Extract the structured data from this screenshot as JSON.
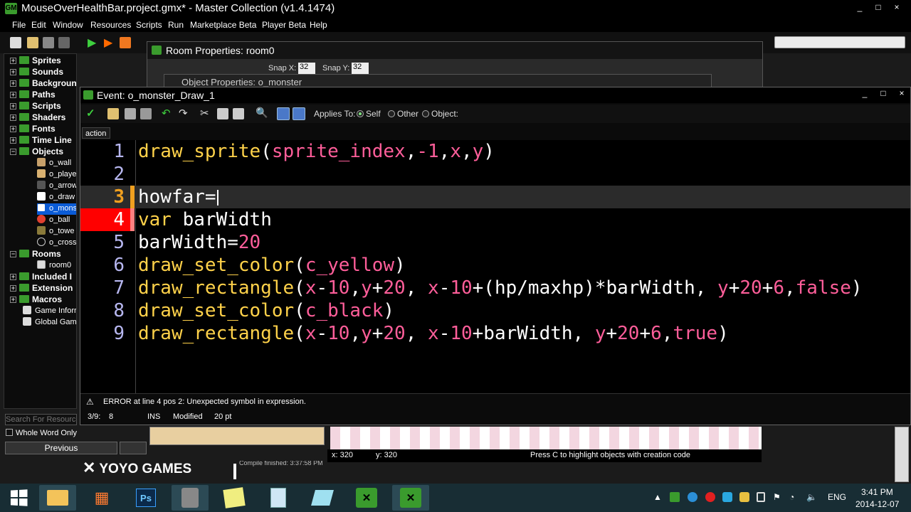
{
  "window": {
    "title": "MouseOverHealthBar.project.gmx* - Master Collection (v1.4.1474)",
    "controls": [
      "_",
      "□",
      "×"
    ]
  },
  "menu": [
    "File",
    "Edit",
    "Window",
    "Resources",
    "Scripts",
    "Run",
    "Marketplace Beta",
    "Player Beta",
    "Help"
  ],
  "resource_tree": {
    "folders": [
      {
        "label": "Sprites"
      },
      {
        "label": "Sounds"
      },
      {
        "label": "Backgrounds"
      },
      {
        "label": "Paths"
      },
      {
        "label": "Scripts"
      },
      {
        "label": "Shaders"
      },
      {
        "label": "Fonts"
      },
      {
        "label": "Time Line"
      },
      {
        "label": "Objects"
      }
    ],
    "objects": [
      {
        "label": "o_wall"
      },
      {
        "label": "o_playe"
      },
      {
        "label": "o_arrow"
      },
      {
        "label": "o_draw"
      },
      {
        "label": "o_monst"
      },
      {
        "label": "o_ball"
      },
      {
        "label": "o_towe"
      },
      {
        "label": "o_cross"
      }
    ],
    "rooms_folder": "Rooms",
    "room0": "room0",
    "included": "Included I",
    "extension": "Extension",
    "macros": "Macros",
    "game_info": "Game Inforr",
    "global_game": "Global Gam"
  },
  "search": {
    "placeholder": "Search For Resource",
    "whole_word": "Whole Word Only",
    "previous": "Previous"
  },
  "branding": "YOYO GAMES",
  "room_window": {
    "title": "Room Properties: room0",
    "snap_x_label": "Snap X:",
    "snap_x": "32",
    "snap_y_label": "Snap Y:",
    "snap_y": "32"
  },
  "object_window": {
    "title": "Object Properties: o_monster"
  },
  "event_window": {
    "title": "Event: o_monster_Draw_1",
    "applies_to": "Applies To:",
    "opt_self": "Self",
    "opt_other": "Other",
    "opt_object": "Object:",
    "tab": "action"
  },
  "code_lines": [
    {
      "n": "1",
      "parts": [
        [
          "fn",
          "draw_sprite"
        ],
        [
          "plain",
          "("
        ],
        [
          "var",
          "sprite_index"
        ],
        [
          "plain",
          ","
        ],
        [
          "num",
          "-1"
        ],
        [
          "plain",
          ","
        ],
        [
          "var",
          "x"
        ],
        [
          "plain",
          ","
        ],
        [
          "var",
          "y"
        ],
        [
          "plain",
          ")"
        ]
      ]
    },
    {
      "n": "2",
      "parts": []
    },
    {
      "n": "3",
      "parts": [
        [
          "plain",
          "howfar="
        ]
      ]
    },
    {
      "n": "4",
      "parts": [
        [
          "fn",
          "var"
        ],
        [
          "plain",
          " barWidth"
        ]
      ]
    },
    {
      "n": "5",
      "parts": [
        [
          "plain",
          "barWidth="
        ],
        [
          "num",
          "20"
        ]
      ]
    },
    {
      "n": "6",
      "parts": [
        [
          "fn",
          "draw_set_color"
        ],
        [
          "plain",
          "("
        ],
        [
          "var",
          "c_yellow"
        ],
        [
          "plain",
          ")"
        ]
      ]
    },
    {
      "n": "7",
      "parts": [
        [
          "fn",
          "draw_rectangle"
        ],
        [
          "plain",
          "("
        ],
        [
          "var",
          "x"
        ],
        [
          "plain",
          "-"
        ],
        [
          "num",
          "10"
        ],
        [
          "plain",
          ","
        ],
        [
          "var",
          "y"
        ],
        [
          "plain",
          "+"
        ],
        [
          "num",
          "20"
        ],
        [
          "plain",
          ", "
        ],
        [
          "var",
          "x"
        ],
        [
          "plain",
          "-"
        ],
        [
          "num",
          "10"
        ],
        [
          "plain",
          "+(hp/maxhp)*barWidth, "
        ],
        [
          "var",
          "y"
        ],
        [
          "plain",
          "+"
        ],
        [
          "num",
          "20"
        ],
        [
          "plain",
          "+"
        ],
        [
          "num",
          "6"
        ],
        [
          "plain",
          ","
        ],
        [
          "kw",
          "false"
        ],
        [
          "plain",
          ")"
        ]
      ]
    },
    {
      "n": "8",
      "parts": [
        [
          "fn",
          "draw_set_color"
        ],
        [
          "plain",
          "("
        ],
        [
          "var",
          "c_black"
        ],
        [
          "plain",
          ")"
        ]
      ]
    },
    {
      "n": "9",
      "parts": [
        [
          "fn",
          "draw_rectangle"
        ],
        [
          "plain",
          "("
        ],
        [
          "var",
          "x"
        ],
        [
          "plain",
          "-"
        ],
        [
          "num",
          "10"
        ],
        [
          "plain",
          ","
        ],
        [
          "var",
          "y"
        ],
        [
          "plain",
          "+"
        ],
        [
          "num",
          "20"
        ],
        [
          "plain",
          ", "
        ],
        [
          "var",
          "x"
        ],
        [
          "plain",
          "-"
        ],
        [
          "num",
          "10"
        ],
        [
          "plain",
          "+barWidth, "
        ],
        [
          "var",
          "y"
        ],
        [
          "plain",
          "+"
        ],
        [
          "num",
          "20"
        ],
        [
          "plain",
          "+"
        ],
        [
          "num",
          "6"
        ],
        [
          "plain",
          ","
        ],
        [
          "kw",
          "true"
        ],
        [
          "plain",
          ")"
        ]
      ]
    }
  ],
  "error_message": "ERROR at line 4 pos 2: Unexpected symbol in expression.",
  "status": {
    "position": "3/9:",
    "col": "8",
    "mode": "INS",
    "modified": "Modified",
    "font_size": "20 pt"
  },
  "room_footer": {
    "x": "x: 320",
    "y": "y: 320",
    "hint": "Press C to highlight objects with creation code",
    "compile": "Compile finished: 3:37:58 PM"
  },
  "taskbar": {
    "apps": [
      "start",
      "explorer",
      "apps",
      "photoshop",
      "app4",
      "notes",
      "calculator",
      "app7",
      "gamemaker1",
      "gamemaker2"
    ],
    "language": "ENG",
    "time": "3:41 PM",
    "date": "2014-12-07"
  },
  "colors": {
    "function": "#ffd24a",
    "variable": "#ff5e9a",
    "line_number": "#b7b7f0",
    "error_line": "#ff0000",
    "gm_green": "#3a9b2d"
  }
}
